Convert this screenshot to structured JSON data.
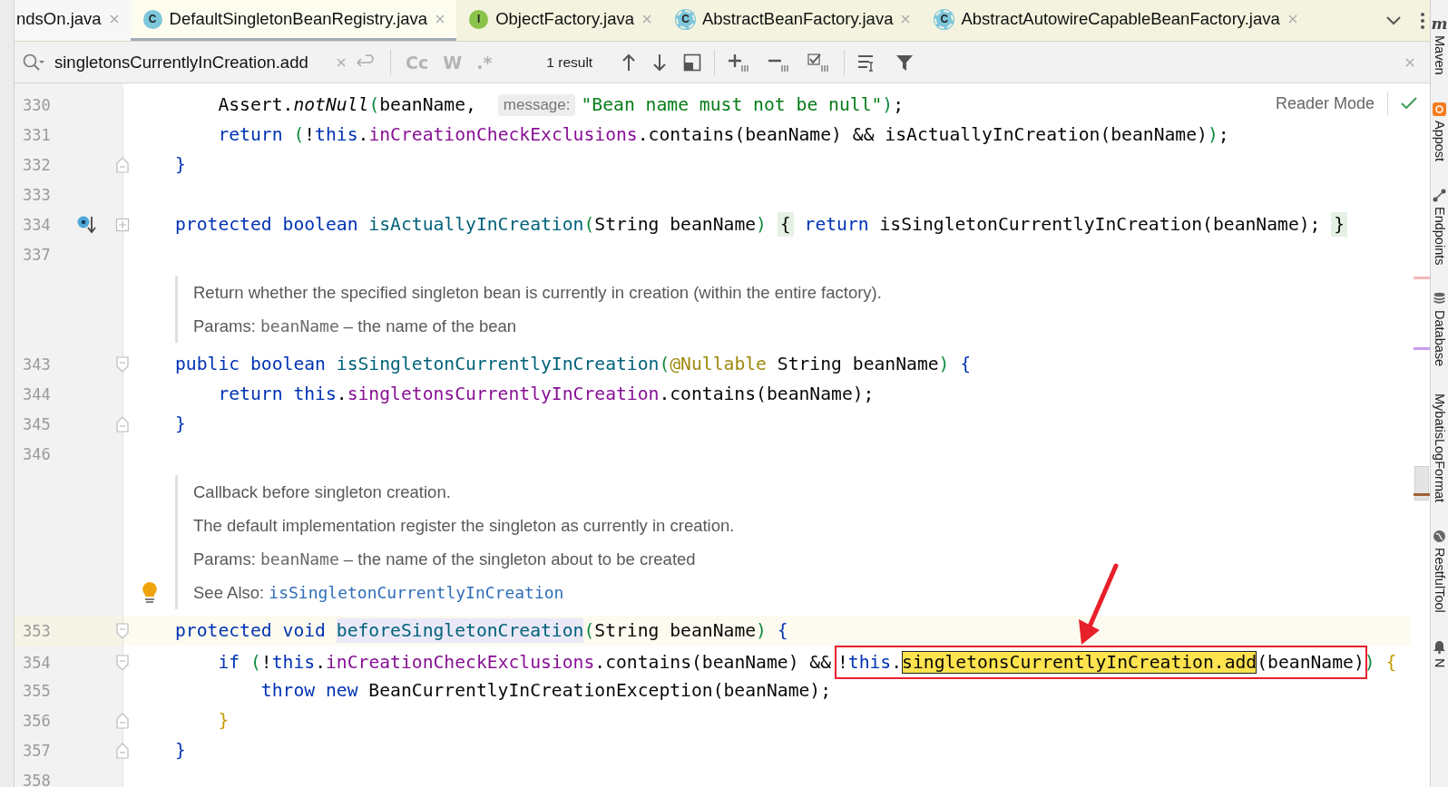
{
  "tabs": [
    {
      "label": "ndsOn.java",
      "selected": false,
      "color": "#f7f7f7"
    },
    {
      "label": "DefaultSingletonBeanRegistry.java",
      "selected": true,
      "color": "#fcfcef",
      "icon": {
        "kind": "class",
        "letter": "C"
      }
    },
    {
      "label": "ObjectFactory.java",
      "selected": false,
      "color": "#f3f3df",
      "icon": {
        "kind": "interface",
        "letter": "I"
      }
    },
    {
      "label": "AbstractBeanFactory.java",
      "selected": false,
      "color": "#f3f3df",
      "icon": {
        "kind": "abstract-class",
        "letter": "C"
      }
    },
    {
      "label": "AbstractAutowireCapableBeanFactory.java",
      "selected": false,
      "color": "#f3f3df",
      "icon": {
        "kind": "abstract-class",
        "letter": "C"
      }
    }
  ],
  "find_bar": {
    "query": "singletonsCurrentlyInCreation.add",
    "options": [
      {
        "text": "Cc",
        "on": false
      },
      {
        "text": "W",
        "on": false
      },
      {
        "text": ".*",
        "on": false
      }
    ],
    "result": "1 result"
  },
  "editor": {
    "reader_mode": "Reader Mode",
    "rows": [
      {
        "kind": "code",
        "number": "330",
        "current": false,
        "tokens": [
          {
            "kind": "plain",
            "text": "    Assert."
          },
          {
            "kind": "italic",
            "text": "notNull"
          },
          {
            "kind": "paren",
            "text": "("
          },
          {
            "kind": "plain",
            "text": "beanName, "
          },
          {
            "kind": "hint",
            "text": "message:"
          },
          {
            "kind": "str",
            "text": "\"Bean name must not be null\""
          },
          {
            "kind": "paren",
            "text": ")"
          },
          {
            "kind": "plain",
            "text": ";"
          }
        ]
      },
      {
        "kind": "code",
        "number": "331",
        "current": false,
        "tokens": [
          {
            "kind": "kw",
            "text": "    return"
          },
          {
            "kind": "paren",
            "text": " ("
          },
          {
            "kind": "plain",
            "text": "!"
          },
          {
            "kind": "kw",
            "text": "this"
          },
          {
            "kind": "plain",
            "text": "."
          },
          {
            "kind": "field",
            "text": "inCreationCheckExclusions"
          },
          {
            "kind": "plain",
            "text": ".contains(beanName) && isActuallyInCreation(beanName)"
          },
          {
            "kind": "paren",
            "text": ")"
          },
          {
            "kind": "plain",
            "text": ";"
          }
        ]
      },
      {
        "kind": "code",
        "number": "332",
        "current": false,
        "fold": {
          "kind": "end"
        },
        "tokens": [
          {
            "kind": "brace",
            "text": "}"
          }
        ]
      },
      {
        "kind": "code",
        "number": "333",
        "current": false
      },
      {
        "kind": "code",
        "number": "334",
        "current": false,
        "fold": {
          "kind": "collapsed"
        },
        "marker": {
          "kind": "override"
        },
        "tokens": [
          {
            "kind": "kw",
            "text": "protected"
          },
          {
            "kind": "kw",
            "text": " boolean"
          },
          {
            "kind": "decl",
            "text": " isActuallyInCreation"
          },
          {
            "kind": "paren",
            "text": "("
          },
          {
            "kind": "plain",
            "text": "String beanName"
          },
          {
            "kind": "paren",
            "text": ") "
          },
          {
            "kind": "fold-brace",
            "text": "{"
          },
          {
            "kind": "kw",
            "text": " return"
          },
          {
            "kind": "plain",
            "text": " isSingletonCurrentlyInCreation(beanName); "
          },
          {
            "kind": "fold-brace",
            "text": "}"
          }
        ]
      },
      {
        "kind": "code",
        "number": "337",
        "current": false
      },
      {
        "kind": "doc",
        "bulb": false,
        "paragraphs": [
          [
            {
              "kind": "text",
              "text": "Return whether the specified singleton bean is currently in creation (within the entire factory)."
            }
          ],
          [
            {
              "kind": "label",
              "text": "Params: "
            },
            {
              "kind": "code",
              "text": "beanName"
            },
            {
              "kind": "text",
              "text": " – the name of the bean"
            }
          ]
        ]
      },
      {
        "kind": "code",
        "number": "343",
        "current": false,
        "fold": {
          "kind": "start"
        },
        "tokens": [
          {
            "kind": "kw",
            "text": "public"
          },
          {
            "kind": "kw",
            "text": " boolean"
          },
          {
            "kind": "decl",
            "text": " isSingletonCurrentlyInCreation"
          },
          {
            "kind": "paren",
            "text": "("
          },
          {
            "kind": "annotation",
            "text": "@Nullable"
          },
          {
            "kind": "plain",
            "text": " String beanName"
          },
          {
            "kind": "paren",
            "text": ")"
          },
          {
            "kind": "brace",
            "text": " {"
          }
        ]
      },
      {
        "kind": "code",
        "number": "344",
        "current": false,
        "tokens": [
          {
            "kind": "kw",
            "text": "    return"
          },
          {
            "kind": "kw",
            "text": " this"
          },
          {
            "kind": "plain",
            "text": "."
          },
          {
            "kind": "field",
            "text": "singletonsCurrentlyInCreation"
          },
          {
            "kind": "plain",
            "text": ".contains(beanName);"
          }
        ]
      },
      {
        "kind": "code",
        "number": "345",
        "current": false,
        "fold": {
          "kind": "end"
        },
        "tokens": [
          {
            "kind": "brace",
            "text": "}"
          }
        ]
      },
      {
        "kind": "code",
        "number": "346",
        "current": false
      },
      {
        "kind": "doc",
        "bulb": true,
        "paragraphs": [
          [
            {
              "kind": "text",
              "text": "Callback before singleton creation."
            }
          ],
          [
            {
              "kind": "text",
              "text": "The default implementation register the singleton as currently in creation."
            }
          ],
          [
            {
              "kind": "label",
              "text": "Params:   "
            },
            {
              "kind": "code",
              "text": "beanName"
            },
            {
              "kind": "text",
              "text": " – the name of the singleton about to be created"
            }
          ],
          [
            {
              "kind": "label",
              "text": "See Also: "
            },
            {
              "kind": "link",
              "text": "isSingletonCurrentlyInCreation"
            }
          ]
        ]
      },
      {
        "kind": "code",
        "number": "353",
        "current": true,
        "fold": {
          "kind": "start"
        },
        "tokens": [
          {
            "kind": "kw",
            "text": "protected"
          },
          {
            "kind": "kw",
            "text": " void "
          },
          {
            "kind": "usage",
            "text": "beforeSingletonCreation"
          },
          {
            "kind": "paren",
            "text": "("
          },
          {
            "kind": "plain",
            "text": "String beanName"
          },
          {
            "kind": "paren",
            "text": ")"
          },
          {
            "kind": "brace",
            "text": " {"
          }
        ]
      },
      {
        "kind": "code",
        "number": "354",
        "current": false,
        "fold": {
          "kind": "start"
        },
        "tokens": [
          {
            "kind": "kw",
            "text": "    if"
          },
          {
            "kind": "paren",
            "text": " ("
          },
          {
            "kind": "plain",
            "text": "!"
          },
          {
            "kind": "kw",
            "text": "this"
          },
          {
            "kind": "plain",
            "text": "."
          },
          {
            "kind": "field",
            "text": "inCreationCheckExclusions"
          },
          {
            "kind": "plain",
            "text": ".contains(beanName) && "
          },
          {
            "kind": "callout",
            "children": [
              {
                "kind": "plain",
                "text": "!"
              },
              {
                "kind": "kw",
                "text": "this"
              },
              {
                "kind": "plain",
                "text": "."
              },
              {
                "kind": "match",
                "text": "singletonsCurrentlyInCreation.add"
              },
              {
                "kind": "plain",
                "text": "(beanName)"
              }
            ]
          },
          {
            "kind": "paren",
            "text": ")"
          },
          {
            "kind": "inner-brace",
            "text": " {"
          }
        ]
      },
      {
        "kind": "code",
        "number": "355",
        "current": false,
        "tokens": [
          {
            "kind": "kw",
            "text": "        throw"
          },
          {
            "kind": "kw",
            "text": " new"
          },
          {
            "kind": "plain",
            "text": " BeanCurrentlyInCreationException(beanName);"
          }
        ]
      },
      {
        "kind": "code",
        "number": "356",
        "current": false,
        "fold": {
          "kind": "end"
        },
        "tokens": [
          {
            "kind": "inner-brace",
            "text": "    }"
          }
        ]
      },
      {
        "kind": "code",
        "number": "357",
        "current": false,
        "fold": {
          "kind": "end"
        },
        "tokens": [
          {
            "kind": "brace",
            "text": "}"
          }
        ]
      },
      {
        "kind": "code",
        "number": "358",
        "current": false
      }
    ]
  },
  "tool_windows": [
    {
      "label": "Maven",
      "kind": "maven",
      "glyph": "m"
    },
    {
      "label": "Appost",
      "kind": "apipost"
    },
    {
      "label": "Endpoints",
      "kind": "endpoints"
    },
    {
      "label": "Database",
      "kind": "database"
    },
    {
      "label": "MybatisLogFormat",
      "kind": "plain"
    },
    {
      "label": "RestfulTool",
      "kind": "restful"
    },
    {
      "label": "N",
      "kind": "notifications"
    }
  ]
}
